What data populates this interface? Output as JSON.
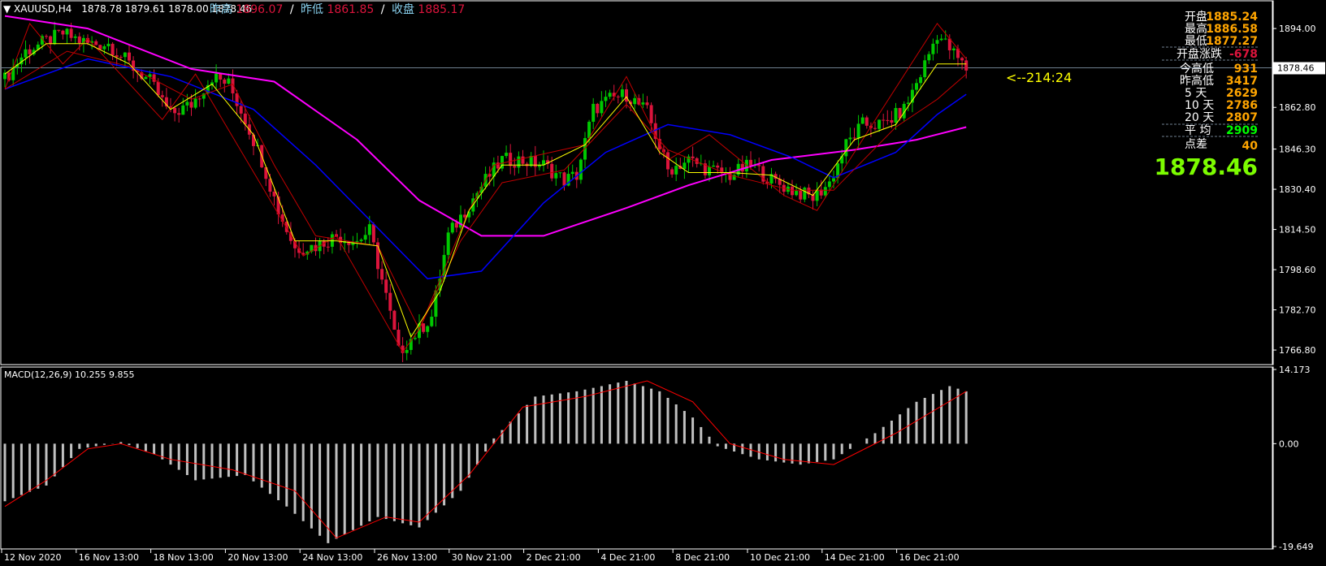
{
  "header": {
    "symbol": "XAUUSD,H4",
    "ohlc": "1878.78 1879.61 1878.00 1878.46",
    "prev_high_label": "昨高",
    "prev_high_value": "1896.07",
    "sep1": "/",
    "prev_low_label": "昨低",
    "prev_low_value": "1861.85",
    "sep2": "/",
    "close_label": "收盘",
    "close_value": "1885.17"
  },
  "info_panel": {
    "open_label": "开盘",
    "open_value": "1885.24",
    "high_label": "最高",
    "high_value": "1886.58",
    "low_label": "最低",
    "low_value": "1877.27",
    "change_label": "开盘涨跌",
    "change_value": "-678",
    "today_range_label": "今高低",
    "today_range_value": "931",
    "yest_range_label": "昨高低",
    "yest_range_value": "3417",
    "d5_label": "5  天",
    "d5_value": "2629",
    "d10_label": "10 天",
    "d10_value": "2786",
    "d20_label": "20 天",
    "d20_value": "2807",
    "avg_label": "平  均",
    "avg_value": "2909",
    "spread_label": "点差",
    "spread_value": "40",
    "big_price": "1878.46"
  },
  "countdown": "<--214:24",
  "macd_label": "MACD(12,26,9) 10.255 9.855",
  "colors": {
    "bull": "#00c800",
    "bear": "#dc143c",
    "ma_fast": "#ffff00",
    "ma_mid": "#c00000",
    "ma_slow": "#0000ff",
    "ma_long": "#ff00ff",
    "macd_hist": "#c0c0c0",
    "macd_signal": "#ff0000",
    "price_line": "#708090",
    "orange": "#ffa500",
    "big_price": "#7cfc00",
    "avg_green": "#00ff00"
  },
  "chart_data": [
    {
      "type": "candlestick",
      "title": "XAUUSD,H4",
      "ylim": [
        1762,
        1904
      ],
      "y_ticks": [
        "1894.00",
        "1878.46",
        "1862.80",
        "1846.30",
        "1830.40",
        "1814.50",
        "1798.60",
        "1782.70",
        "1766.80"
      ],
      "x_ticks": [
        "12 Nov 2020",
        "16 Nov 13:00",
        "18 Nov 13:00",
        "20 Nov 13:00",
        "24 Nov 13:00",
        "26 Nov 13:00",
        "30 Nov 21:00",
        "2 Dec 21:00",
        "4 Dec 21:00",
        "8 Dec 21:00",
        "10 Dec 21:00",
        "14 Dec 21:00",
        "16 Dec 21:00"
      ],
      "current_price": 1878.46,
      "close_path": [
        [
          0,
          1874
        ],
        [
          5,
          1885
        ],
        [
          10,
          1889
        ],
        [
          14,
          1892
        ],
        [
          20,
          1888
        ],
        [
          25,
          1888
        ],
        [
          30,
          1880
        ],
        [
          35,
          1873
        ],
        [
          40,
          1860
        ],
        [
          45,
          1864
        ],
        [
          50,
          1875
        ],
        [
          54,
          1872
        ],
        [
          58,
          1858
        ],
        [
          62,
          1842
        ],
        [
          66,
          1822
        ],
        [
          70,
          1807
        ],
        [
          75,
          1808
        ],
        [
          80,
          1812
        ],
        [
          85,
          1810
        ],
        [
          88,
          1814
        ],
        [
          92,
          1788
        ],
        [
          95,
          1766
        ],
        [
          99,
          1773
        ],
        [
          103,
          1780
        ],
        [
          107,
          1812
        ],
        [
          111,
          1822
        ],
        [
          116,
          1834
        ],
        [
          120,
          1842
        ],
        [
          124,
          1842
        ],
        [
          130,
          1840
        ],
        [
          135,
          1834
        ],
        [
          138,
          1836
        ],
        [
          142,
          1862
        ],
        [
          146,
          1866
        ],
        [
          150,
          1868
        ],
        [
          155,
          1861
        ],
        [
          160,
          1838
        ],
        [
          165,
          1842
        ],
        [
          170,
          1838
        ],
        [
          175,
          1836
        ],
        [
          180,
          1840
        ],
        [
          185,
          1834
        ],
        [
          190,
          1830
        ],
        [
          195,
          1827
        ],
        [
          199,
          1833
        ],
        [
          203,
          1848
        ],
        [
          207,
          1856
        ],
        [
          212,
          1856
        ],
        [
          217,
          1862
        ],
        [
          221,
          1876
        ],
        [
          225,
          1892
        ],
        [
          228,
          1886
        ],
        [
          232,
          1878
        ]
      ],
      "ma_fast": [
        [
          0,
          1876
        ],
        [
          10,
          1888
        ],
        [
          20,
          1888
        ],
        [
          30,
          1880
        ],
        [
          40,
          1862
        ],
        [
          50,
          1872
        ],
        [
          60,
          1852
        ],
        [
          70,
          1810
        ],
        [
          80,
          1810
        ],
        [
          90,
          1808
        ],
        [
          98,
          1772
        ],
        [
          105,
          1790
        ],
        [
          112,
          1822
        ],
        [
          120,
          1840
        ],
        [
          130,
          1840
        ],
        [
          140,
          1848
        ],
        [
          150,
          1867
        ],
        [
          158,
          1845
        ],
        [
          165,
          1837
        ],
        [
          175,
          1837
        ],
        [
          185,
          1836
        ],
        [
          195,
          1828
        ],
        [
          205,
          1850
        ],
        [
          215,
          1856
        ],
        [
          225,
          1880
        ],
        [
          232,
          1880
        ]
      ],
      "ma_mid": [
        [
          0,
          1870
        ],
        [
          15,
          1885
        ],
        [
          30,
          1879
        ],
        [
          45,
          1866
        ],
        [
          55,
          1872
        ],
        [
          65,
          1840
        ],
        [
          75,
          1812
        ],
        [
          90,
          1808
        ],
        [
          100,
          1775
        ],
        [
          110,
          1810
        ],
        [
          120,
          1833
        ],
        [
          135,
          1838
        ],
        [
          150,
          1864
        ],
        [
          160,
          1846
        ],
        [
          175,
          1836
        ],
        [
          190,
          1830
        ],
        [
          200,
          1830
        ],
        [
          215,
          1855
        ],
        [
          225,
          1866
        ],
        [
          232,
          1876
        ]
      ],
      "ma_slow": [
        [
          0,
          1870
        ],
        [
          20,
          1882
        ],
        [
          40,
          1875
        ],
        [
          60,
          1862
        ],
        [
          75,
          1840
        ],
        [
          90,
          1815
        ],
        [
          102,
          1795
        ],
        [
          115,
          1798
        ],
        [
          130,
          1825
        ],
        [
          145,
          1845
        ],
        [
          160,
          1856
        ],
        [
          175,
          1852
        ],
        [
          190,
          1843
        ],
        [
          200,
          1835
        ],
        [
          215,
          1845
        ],
        [
          225,
          1860
        ],
        [
          232,
          1868
        ]
      ],
      "ma_long": [
        [
          0,
          1899
        ],
        [
          20,
          1894
        ],
        [
          45,
          1878
        ],
        [
          65,
          1873
        ],
        [
          85,
          1850
        ],
        [
          100,
          1826
        ],
        [
          115,
          1812
        ],
        [
          130,
          1812
        ],
        [
          150,
          1823
        ],
        [
          165,
          1832
        ],
        [
          185,
          1842
        ],
        [
          205,
          1846
        ],
        [
          220,
          1850
        ],
        [
          232,
          1855
        ]
      ],
      "zigzag": [
        [
          0,
          1870
        ],
        [
          6,
          1896
        ],
        [
          14,
          1880
        ],
        [
          20,
          1890
        ],
        [
          38,
          1858
        ],
        [
          46,
          1876
        ],
        [
          72,
          1804
        ],
        [
          80,
          1812
        ],
        [
          96,
          1766
        ],
        [
          100,
          1775
        ],
        [
          112,
          1822
        ],
        [
          118,
          1840
        ],
        [
          140,
          1848
        ],
        [
          150,
          1875
        ],
        [
          160,
          1842
        ],
        [
          170,
          1852
        ],
        [
          188,
          1828
        ],
        [
          196,
          1822
        ],
        [
          225,
          1896
        ],
        [
          232,
          1882
        ]
      ]
    },
    {
      "type": "bar",
      "title": "MACD(12,26,9) 10.255 9.855",
      "ylim": [
        -19.649,
        14.173
      ],
      "y_ticks": [
        "14.173",
        "0.00",
        "-19.649"
      ],
      "macd_line": [
        10.255
      ],
      "signal_line": [
        9.855
      ],
      "hist_path": [
        [
          0,
          -11
        ],
        [
          10,
          -8
        ],
        [
          18,
          -1
        ],
        [
          28,
          0.3
        ],
        [
          36,
          -2
        ],
        [
          46,
          -7
        ],
        [
          58,
          -6
        ],
        [
          68,
          -12
        ],
        [
          78,
          -19
        ],
        [
          90,
          -14
        ],
        [
          100,
          -16
        ],
        [
          110,
          -9
        ],
        [
          118,
          1
        ],
        [
          128,
          9
        ],
        [
          138,
          10
        ],
        [
          150,
          12
        ],
        [
          158,
          10
        ],
        [
          166,
          5
        ],
        [
          172,
          -0.5
        ],
        [
          182,
          -3
        ],
        [
          192,
          -4
        ],
        [
          200,
          -3
        ],
        [
          210,
          2
        ],
        [
          220,
          8
        ],
        [
          228,
          11
        ],
        [
          232,
          10
        ]
      ],
      "signal_path": [
        [
          0,
          -12
        ],
        [
          10,
          -7
        ],
        [
          20,
          -1
        ],
        [
          28,
          0
        ],
        [
          40,
          -3
        ],
        [
          55,
          -5
        ],
        [
          70,
          -9
        ],
        [
          80,
          -18
        ],
        [
          92,
          -14
        ],
        [
          100,
          -15
        ],
        [
          112,
          -6
        ],
        [
          125,
          7
        ],
        [
          140,
          9
        ],
        [
          155,
          12
        ],
        [
          166,
          8
        ],
        [
          175,
          0
        ],
        [
          188,
          -3
        ],
        [
          200,
          -4
        ],
        [
          215,
          2
        ],
        [
          232,
          10
        ]
      ]
    }
  ]
}
